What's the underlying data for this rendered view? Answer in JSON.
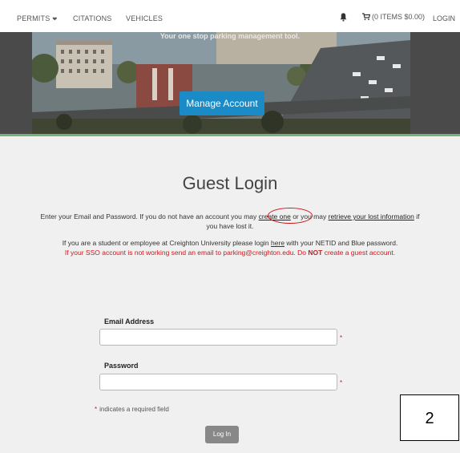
{
  "nav": {
    "permits": "PERMITS",
    "citations": "CITATIONS",
    "vehicles": "VEHICLES",
    "cart": "(0 ITEMS $0.00)",
    "login": "LOGIN"
  },
  "hero": {
    "tagline": "Your one stop parking management tool.",
    "manage_button": "Manage Account"
  },
  "page": {
    "title": "Guest Login",
    "intro_1": "Enter your Email and Password.  If you do not have an account you may ",
    "create_link": "create one",
    "intro_2": " or you may ",
    "retrieve_link": "retrieve your lost information",
    "intro_3": " if you have lost it.",
    "sso_1a": "If you are a student or employee at Creighton University please login ",
    "sso_here": "here",
    "sso_1b": " with your NETID and Blue password.",
    "sso_2a": "If your SSO account is not working send an email to parking@creighton.edu. Do ",
    "sso_not": "NOT",
    "sso_2b": " create a guest account."
  },
  "form": {
    "email_label": "Email Address",
    "email_value": "",
    "password_label": "Password",
    "password_value": "",
    "required_star": "*",
    "required_note": "indicates a required field",
    "login_button": "Log In"
  },
  "annotation": {
    "number": "2"
  },
  "colors": {
    "accent": "#1a8bc6",
    "required": "#d0161a",
    "hero_border": "#78b07a"
  }
}
